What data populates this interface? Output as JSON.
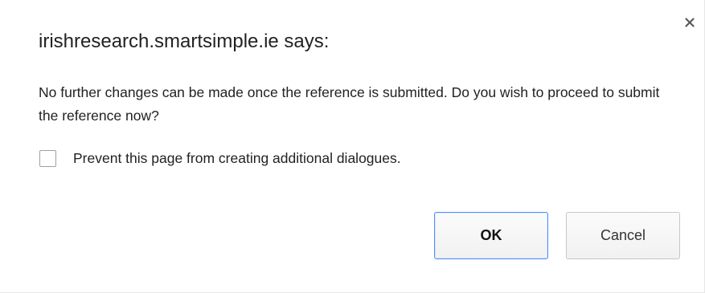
{
  "dialog": {
    "title": "irishresearch.smartsimple.ie says:",
    "message": "No further changes can be made once the reference is submitted. Do you wish to proceed to submit the reference now?",
    "prevent_label": "Prevent this page from creating additional dialogues.",
    "prevent_checked": false,
    "ok_label": "OK",
    "cancel_label": "Cancel",
    "close_icon": "close-icon"
  },
  "colors": {
    "focus_border": "#4d90fe",
    "text": "#222222",
    "button_border": "#c6c6c6"
  }
}
